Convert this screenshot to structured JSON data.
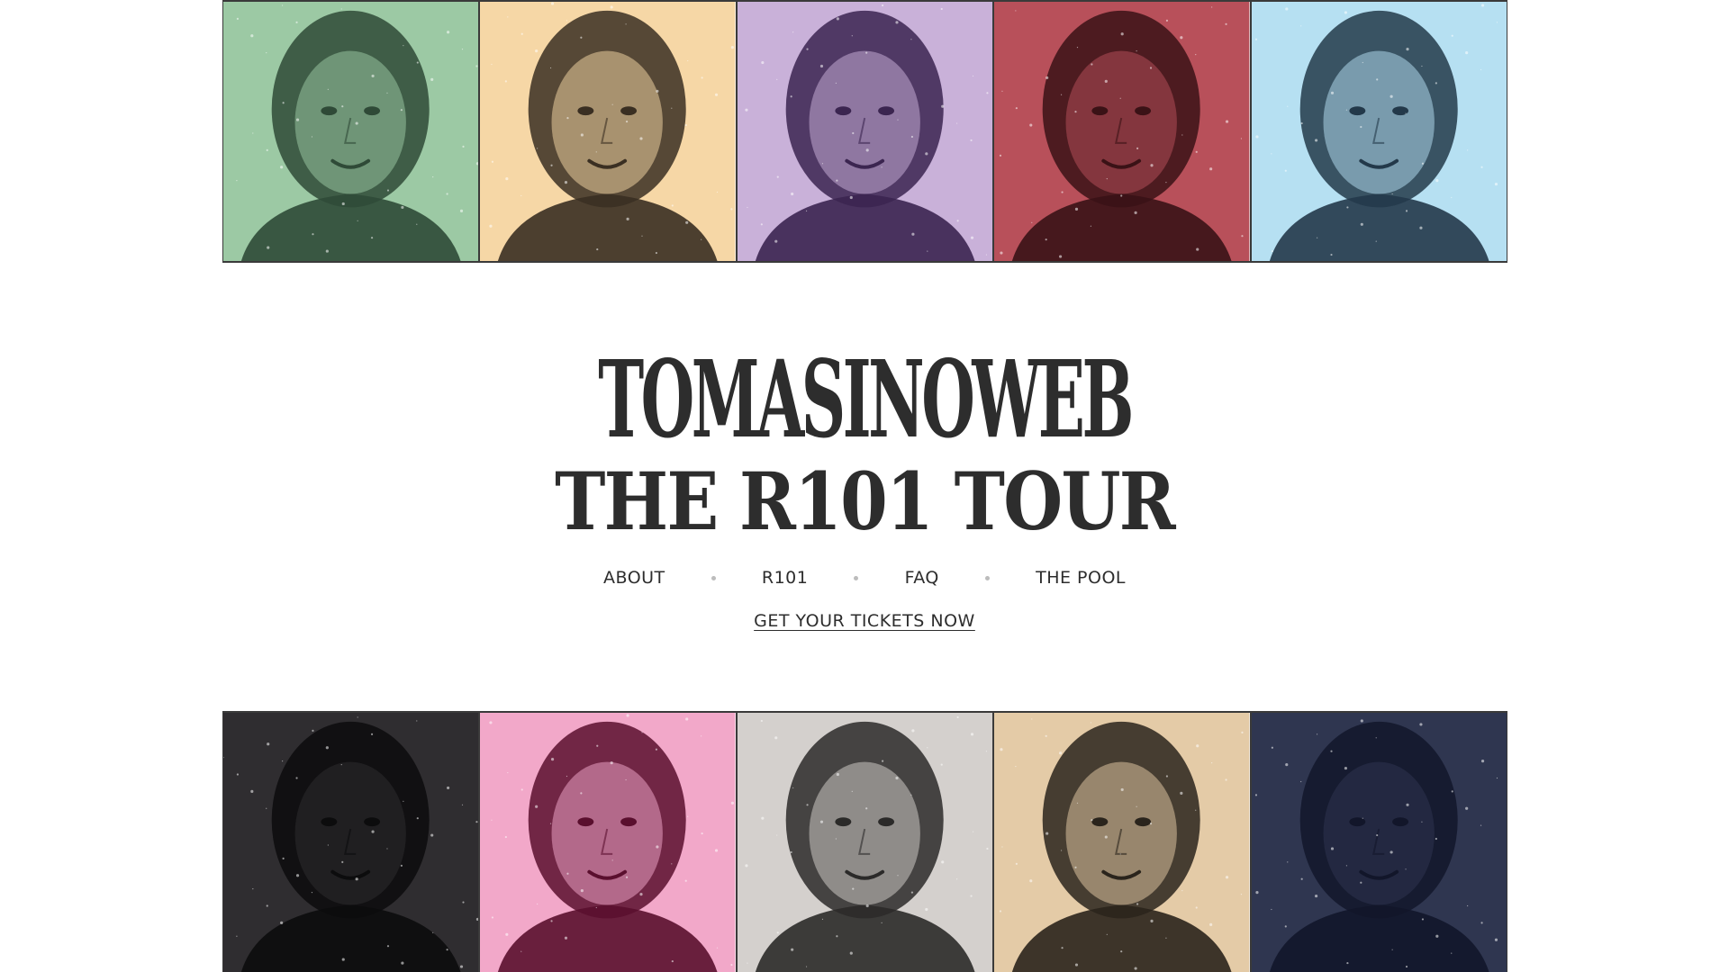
{
  "site": {
    "logo_line1": "TOMASINOWEB",
    "logo_line2": "THE R101 TOUR"
  },
  "nav": {
    "items": [
      {
        "label": "ABOUT"
      },
      {
        "label": "R101"
      },
      {
        "label": "FAQ"
      },
      {
        "label": "THE POOL"
      }
    ],
    "cta_label": "GET YOUR TICKETS NOW"
  },
  "portraits": {
    "top": [
      {
        "bg": "#9cc9a4",
        "tone": "#2f4a37"
      },
      {
        "bg": "#f6d7a6",
        "tone": "#3a2f22"
      },
      {
        "bg": "#c9b1d9",
        "tone": "#3b2550"
      },
      {
        "bg": "#b8505a",
        "tone": "#3a1216"
      },
      {
        "bg": "#b6e0f2",
        "tone": "#23394a"
      }
    ],
    "bottom": [
      {
        "bg": "#2f2d30",
        "tone": "#0c0c0d"
      },
      {
        "bg": "#f2a8c9",
        "tone": "#5a0f2e"
      },
      {
        "bg": "#d4d0cd",
        "tone": "#2b2a29"
      },
      {
        "bg": "#e4cba7",
        "tone": "#2a241c"
      },
      {
        "bg": "#2f3650",
        "tone": "#12162a"
      }
    ]
  },
  "colors": {
    "text": "#2d2d2d",
    "border": "#3a3a3a",
    "nav_dot": "#bcbcbc",
    "background": "#ffffff"
  }
}
